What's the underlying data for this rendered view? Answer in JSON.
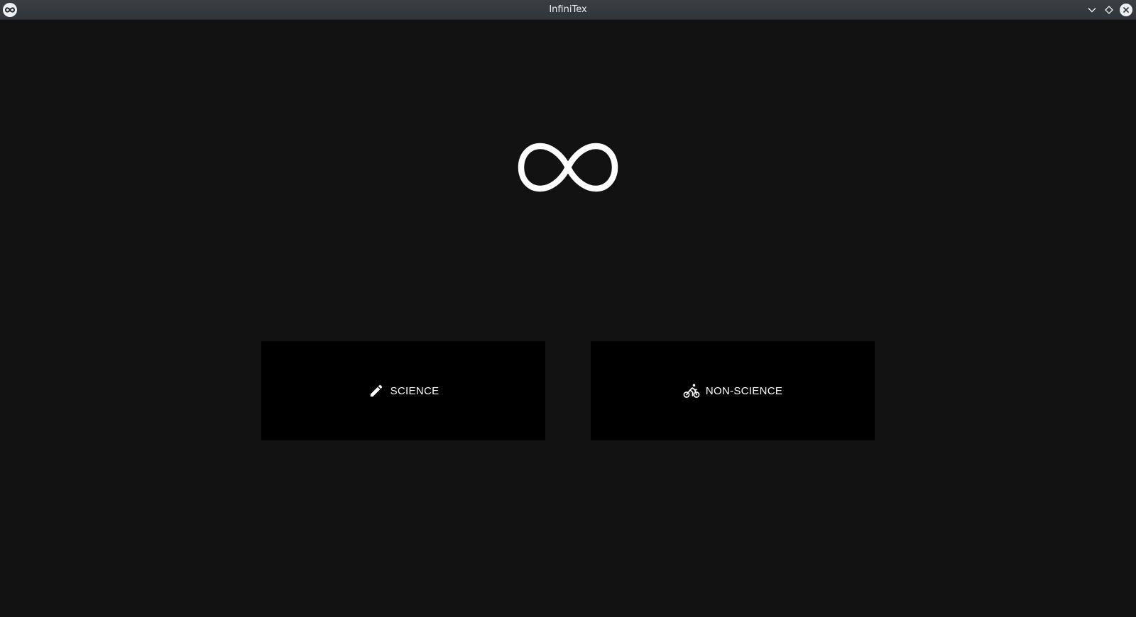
{
  "window": {
    "title": "InfiniTex",
    "app_icon": "infinity-icon",
    "controls": [
      "minimize-icon",
      "maximize-icon",
      "close-icon"
    ]
  },
  "main": {
    "logo_icon": "infinity-icon",
    "choices": [
      {
        "label": "SCIENCE",
        "icon": "pencil-icon"
      },
      {
        "label": "NON-SCIENCE",
        "icon": "bicycle-icon"
      }
    ]
  },
  "colors": {
    "background": "#121212",
    "card": "#000000",
    "titlebar": "#31363b",
    "text": "#ffffff"
  }
}
